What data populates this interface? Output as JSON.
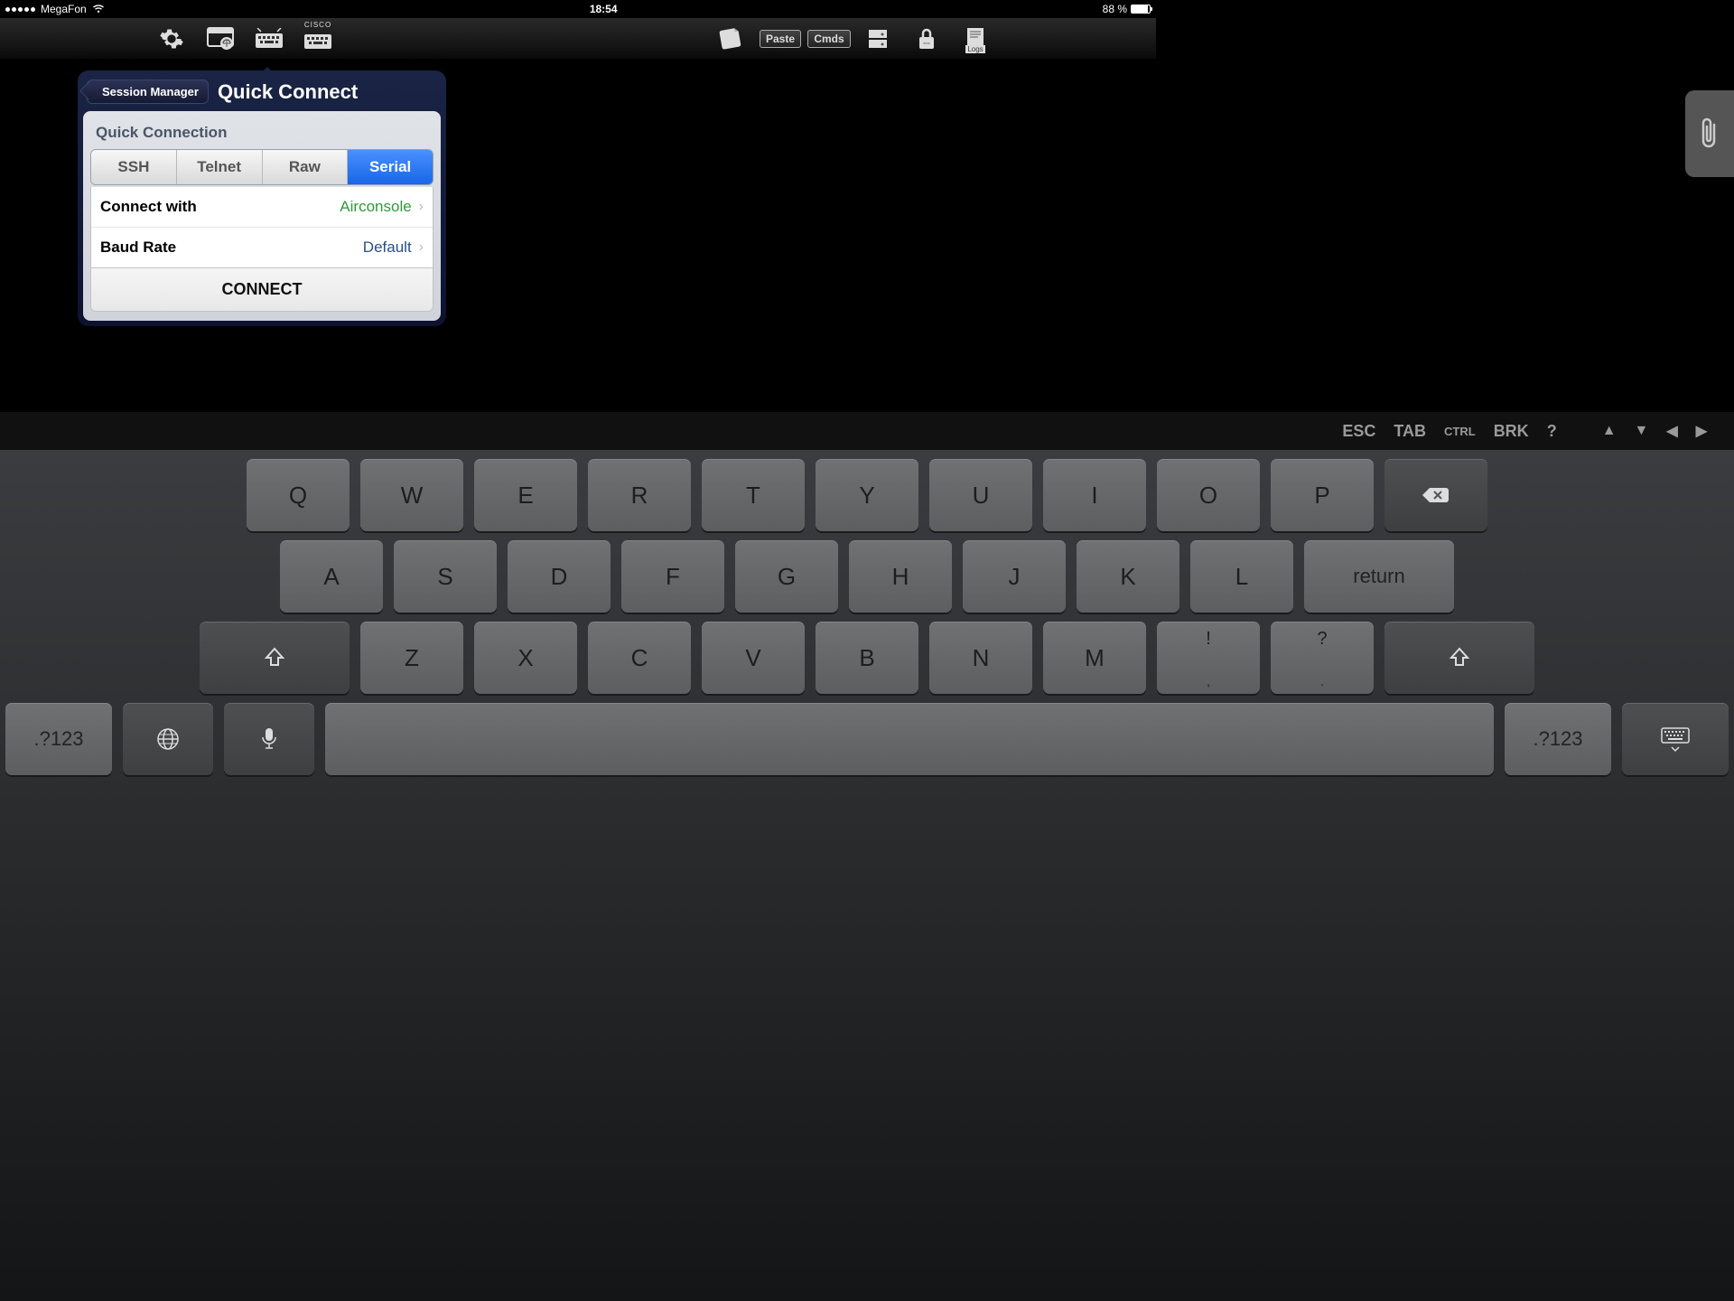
{
  "statusbar": {
    "carrier": "MegaFon",
    "time": "18:54",
    "battery": "88 %"
  },
  "toolbar": {
    "cisco_label": "CISCO",
    "paste": "Paste",
    "cmds": "Cmds",
    "logs": "Logs"
  },
  "popover": {
    "back": "Session Manager",
    "title": "Quick Connect",
    "section": "Quick Connection",
    "tabs": [
      "SSH",
      "Telnet",
      "Raw",
      "Serial"
    ],
    "active_tab": 3,
    "rows": [
      {
        "label": "Connect with",
        "value": "Airconsole",
        "style": "green"
      },
      {
        "label": "Baud Rate",
        "value": "Default",
        "style": "blue"
      }
    ],
    "connect": "CONNECT"
  },
  "fnbar": {
    "esc": "ESC",
    "tab": "TAB",
    "ctrl": "CTRL",
    "brk": "BRK",
    "q": "?"
  },
  "keyboard": {
    "row1": [
      "Q",
      "W",
      "E",
      "R",
      "T",
      "Y",
      "U",
      "I",
      "O",
      "P"
    ],
    "row2": [
      "A",
      "S",
      "D",
      "F",
      "G",
      "H",
      "J",
      "K",
      "L"
    ],
    "return": "return",
    "row3": [
      "Z",
      "X",
      "C",
      "V",
      "B",
      "N",
      "M"
    ],
    "punct1_top": "!",
    "punct1_bot": ",",
    "punct2_top": "?",
    "punct2_bot": ".",
    "numkey": ".?123"
  }
}
